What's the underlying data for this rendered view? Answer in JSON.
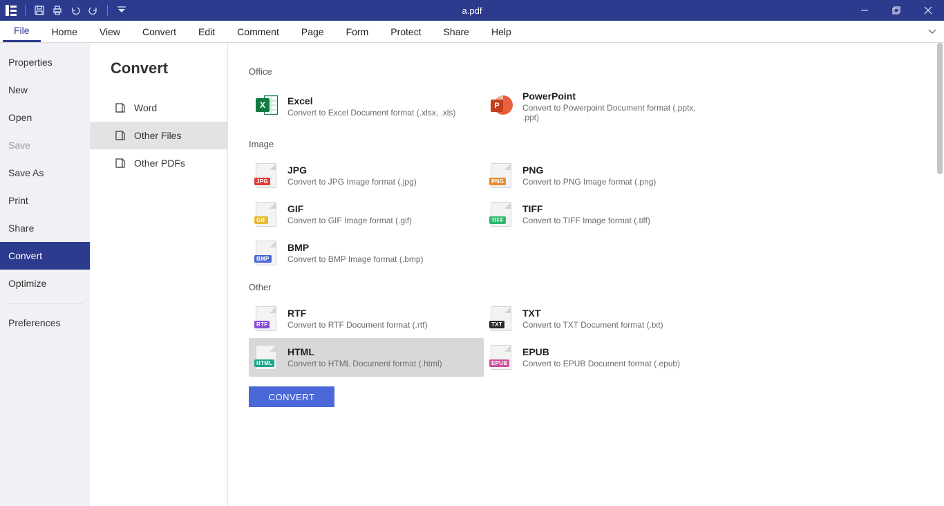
{
  "title": "a.pdf",
  "menu": [
    "File",
    "Home",
    "View",
    "Convert",
    "Edit",
    "Comment",
    "Page",
    "Form",
    "Protect",
    "Share",
    "Help"
  ],
  "menu_active": "File",
  "file_sidebar": [
    {
      "label": "Properties",
      "state": "normal"
    },
    {
      "label": "New",
      "state": "normal"
    },
    {
      "label": "Open",
      "state": "normal"
    },
    {
      "label": "Save",
      "state": "disabled"
    },
    {
      "label": "Save As",
      "state": "normal"
    },
    {
      "label": "Print",
      "state": "normal"
    },
    {
      "label": "Share",
      "state": "normal"
    },
    {
      "label": "Convert",
      "state": "selected"
    },
    {
      "label": "Optimize",
      "state": "normal"
    },
    {
      "label": "__sep__",
      "state": "sep"
    },
    {
      "label": "Preferences",
      "state": "normal"
    }
  ],
  "convert": {
    "heading": "Convert",
    "tabs": [
      {
        "label": "Word",
        "selected": false
      },
      {
        "label": "Other Files",
        "selected": true
      },
      {
        "label": "Other PDFs",
        "selected": false
      }
    ],
    "sections": [
      {
        "title": "Office",
        "items": [
          {
            "id": "excel",
            "title": "Excel",
            "desc": "Convert to Excel Document format (.xlsx, .xls)",
            "icon": "excel",
            "selected": false
          },
          {
            "id": "ppt",
            "title": "PowerPoint",
            "desc": "Convert to Powerpoint Document format (.pptx, .ppt)",
            "icon": "ppt",
            "selected": false
          }
        ]
      },
      {
        "title": "Image",
        "items": [
          {
            "id": "jpg",
            "title": "JPG",
            "desc": "Convert to JPG Image format (.jpg)",
            "icon": "file",
            "tag": "JPG",
            "tagColor": "#e23b3b",
            "selected": false
          },
          {
            "id": "png",
            "title": "PNG",
            "desc": "Convert to PNG Image format (.png)",
            "icon": "file",
            "tag": "PNG",
            "tagColor": "#e88b2d",
            "selected": false
          },
          {
            "id": "gif",
            "title": "GIF",
            "desc": "Convert to GIF Image format (.gif)",
            "icon": "file",
            "tag": "GIF",
            "tagColor": "#e6b92e",
            "selected": false
          },
          {
            "id": "tiff",
            "title": "TIFF",
            "desc": "Convert to TIFF Image format (.tiff)",
            "icon": "file",
            "tag": "TIFF",
            "tagColor": "#2fb66a",
            "selected": false
          },
          {
            "id": "bmp",
            "title": "BMP",
            "desc": "Convert to BMP Image format (.bmp)",
            "icon": "file",
            "tag": "BMP",
            "tagColor": "#4a68d8",
            "selected": false
          }
        ]
      },
      {
        "title": "Other",
        "items": [
          {
            "id": "rtf",
            "title": "RTF",
            "desc": "Convert to RTF Document format (.rtf)",
            "icon": "file",
            "tag": "RTF",
            "tagColor": "#8a4ad8",
            "selected": false
          },
          {
            "id": "txt",
            "title": "TXT",
            "desc": "Convert to TXT Document format (.txt)",
            "icon": "file",
            "tag": "TXT",
            "tagColor": "#2b2b2b",
            "selected": false
          },
          {
            "id": "html",
            "title": "HTML",
            "desc": "Convert to HTML Document format (.html)",
            "icon": "file",
            "tag": "HTML",
            "tagColor": "#1aa88a",
            "selected": true
          },
          {
            "id": "epub",
            "title": "EPUB",
            "desc": "Convert to EPUB Document format (.epub)",
            "icon": "file",
            "tag": "EPUB",
            "tagColor": "#d14fa0",
            "selected": false
          }
        ]
      }
    ],
    "button": "CONVERT"
  }
}
